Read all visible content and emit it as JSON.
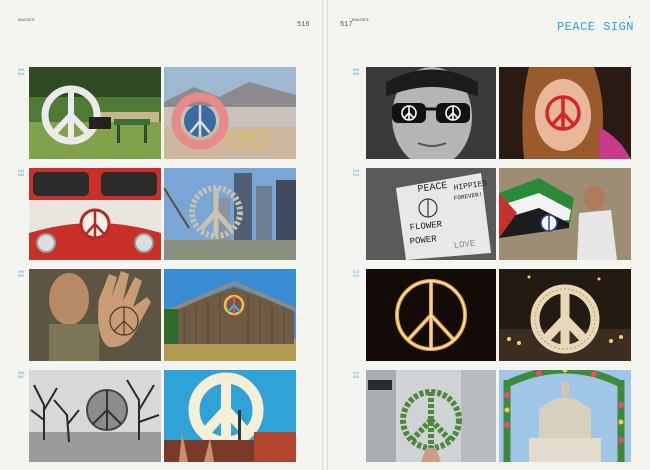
{
  "left_page": {
    "section_label": "IMAGES",
    "page_number": "516",
    "captions": [
      {
        "a": "500",
        "b": "501"
      },
      {
        "a": "502",
        "b": "503"
      },
      {
        "a": "504",
        "b": "505"
      },
      {
        "a": "506",
        "b": "507"
      }
    ]
  },
  "right_page": {
    "section_label": "IMAGES",
    "page_number": "517",
    "title": "PEACE SIGN",
    "captions": [
      {
        "a": "508",
        "b": "509"
      },
      {
        "a": "510",
        "b": "511"
      },
      {
        "a": "512",
        "b": "513"
      },
      {
        "a": "514",
        "b": "515"
      }
    ]
  },
  "photos": {
    "sign_text_1": "PEACE",
    "sign_text_2": "HIPPIES",
    "sign_text_3": "FOREVER!",
    "sign_text_4": "FLOWER",
    "sign_text_5": "POWER",
    "sign_text_6": "LOVE"
  },
  "colors": {
    "accent": "#2aa3d8",
    "paper": "#f4f4f1"
  }
}
